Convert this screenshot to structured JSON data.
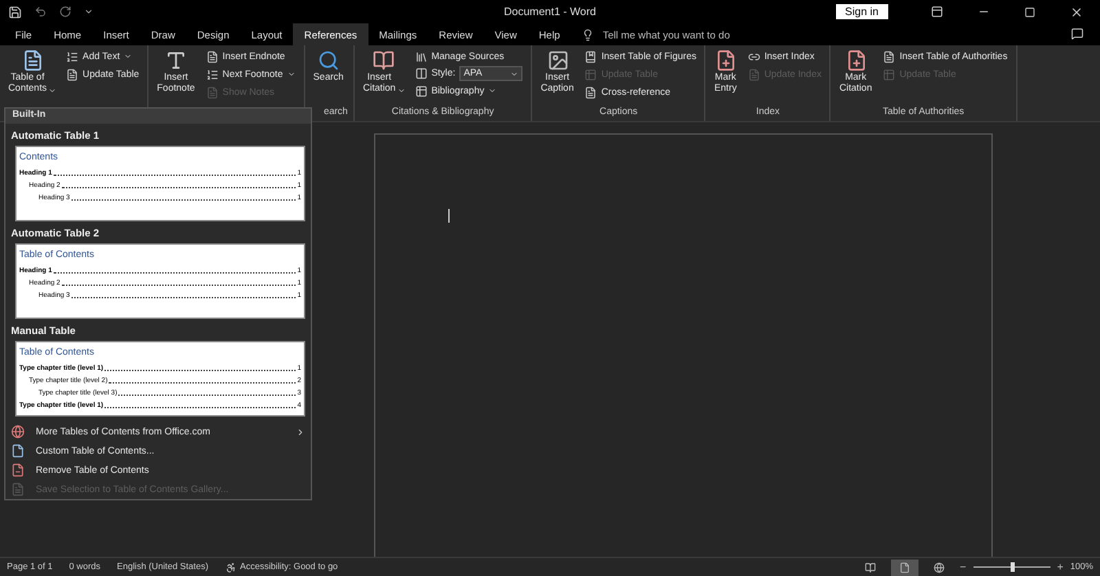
{
  "window": {
    "title": "Document1 - Word",
    "sign_in": "Sign in"
  },
  "tabs": [
    {
      "label": "File",
      "selected": false
    },
    {
      "label": "Home",
      "selected": false
    },
    {
      "label": "Insert",
      "selected": false
    },
    {
      "label": "Draw",
      "selected": false
    },
    {
      "label": "Design",
      "selected": false
    },
    {
      "label": "Layout",
      "selected": false
    },
    {
      "label": "References",
      "selected": true
    },
    {
      "label": "Mailings",
      "selected": false
    },
    {
      "label": "Review",
      "selected": false
    },
    {
      "label": "View",
      "selected": false
    },
    {
      "label": "Help",
      "selected": false
    }
  ],
  "tell_me": {
    "placeholder": "Tell me what you want to do"
  },
  "ribbon": {
    "groups": [
      {
        "items": [
          {
            "kind": "large",
            "lines": [
              "Table of",
              "Contents"
            ],
            "dropdown": true,
            "disabled": false
          },
          {
            "kind": "small",
            "label": "Add Text",
            "dropdown": true,
            "disabled": false
          },
          {
            "kind": "small",
            "label": "Update Table",
            "dropdown": false,
            "disabled": false
          }
        ]
      },
      {
        "items": [
          {
            "kind": "large",
            "lines": [
              "Insert",
              "Footnote"
            ],
            "dropdown": false,
            "disabled": false
          },
          {
            "kind": "small",
            "label": "Insert Endnote",
            "dropdown": false,
            "disabled": false
          },
          {
            "kind": "small",
            "label": "Next Footnote",
            "dropdown": true,
            "disabled": false
          },
          {
            "kind": "small",
            "label": "Show Notes",
            "dropdown": false,
            "disabled": true
          }
        ]
      },
      {
        "label": "earch",
        "items": [
          {
            "kind": "large",
            "lines": [
              "Search"
            ],
            "dropdown": false,
            "disabled": false
          }
        ]
      },
      {
        "label": "Citations & Bibliography",
        "items": [
          {
            "kind": "large",
            "lines": [
              "Insert",
              "Citation"
            ],
            "dropdown": true,
            "disabled": false
          },
          {
            "kind": "small",
            "label": "Manage Sources",
            "dropdown": false,
            "disabled": false
          },
          {
            "kind": "select",
            "label": "Style:",
            "value": "APA",
            "dropdown": true,
            "disabled": false
          },
          {
            "kind": "small",
            "label": "Bibliography",
            "dropdown": true,
            "disabled": false
          }
        ]
      },
      {
        "label": "Captions",
        "items": [
          {
            "kind": "large",
            "lines": [
              "Insert",
              "Caption"
            ],
            "dropdown": false,
            "disabled": false
          },
          {
            "kind": "small",
            "label": "Insert Table of Figures",
            "dropdown": false,
            "disabled": false
          },
          {
            "kind": "small",
            "label": "Update Table",
            "dropdown": false,
            "disabled": true
          },
          {
            "kind": "small",
            "label": "Cross-reference",
            "dropdown": false,
            "disabled": false
          }
        ]
      },
      {
        "label": "Index",
        "items": [
          {
            "kind": "large",
            "lines": [
              "Mark",
              "Entry"
            ],
            "dropdown": false,
            "disabled": false
          },
          {
            "kind": "small",
            "label": "Insert Index",
            "dropdown": false,
            "disabled": false
          },
          {
            "kind": "small",
            "label": "Update Index",
            "dropdown": false,
            "disabled": true
          }
        ]
      },
      {
        "label": "Table of Authorities",
        "items": [
          {
            "kind": "large",
            "lines": [
              "Mark",
              "Citation"
            ],
            "dropdown": false,
            "disabled": false
          },
          {
            "kind": "small",
            "label": "Insert Table of Authorities",
            "dropdown": false,
            "disabled": false
          },
          {
            "kind": "small",
            "label": "Update Table",
            "dropdown": false,
            "disabled": true
          }
        ]
      }
    ]
  },
  "toc_menu": {
    "header": "Built-In",
    "sections": [
      {
        "title": "Automatic Table 1",
        "preview": {
          "heading": "Contents",
          "entries": [
            {
              "text": "Heading 1",
              "page": "1",
              "children": [
                {
                  "text": "Heading 2",
                  "page": "1",
                  "children": [
                    {
                      "text": "Heading 3",
                      "page": "1"
                    }
                  ]
                }
              ]
            }
          ]
        }
      },
      {
        "title": "Automatic Table 2",
        "preview": {
          "heading": "Table of Contents",
          "entries": [
            {
              "text": "Heading 1",
              "page": "1",
              "children": [
                {
                  "text": "Heading 2",
                  "page": "1",
                  "children": [
                    {
                      "text": "Heading 3",
                      "page": "1"
                    }
                  ]
                }
              ]
            }
          ]
        }
      },
      {
        "title": "Manual Table",
        "preview": {
          "heading": "Table of Contents",
          "entries": [
            {
              "text": "Type chapter title (level 1)",
              "page": "1",
              "children": [
                {
                  "text": "Type chapter title (level 2)",
                  "page": "2",
                  "children": [
                    {
                      "text": "Type chapter title (level 3)",
                      "page": "3"
                    }
                  ]
                }
              ]
            },
            {
              "text": "Type chapter title (level 1)",
              "page": "4"
            }
          ]
        }
      }
    ],
    "actions": [
      {
        "label": "More Tables of Contents from Office.com",
        "submenu": true,
        "disabled": false
      },
      {
        "label": "Custom Table of Contents...",
        "submenu": false,
        "disabled": false
      },
      {
        "label": "Remove Table of Contents",
        "submenu": false,
        "disabled": false
      },
      {
        "label": "Save Selection to Table of Contents Gallery...",
        "submenu": false,
        "disabled": true
      }
    ]
  },
  "status_bar": {
    "items": [
      "Page 1 of 1",
      "0 words",
      "English (United States)"
    ],
    "accessibility": "Accessibility: Good to go",
    "views": [
      {
        "selected": false
      },
      {
        "selected": true
      },
      {
        "selected": false
      }
    ],
    "zoom": {
      "out": "−",
      "in": "+",
      "level": 0.5,
      "reading": "100%"
    }
  }
}
